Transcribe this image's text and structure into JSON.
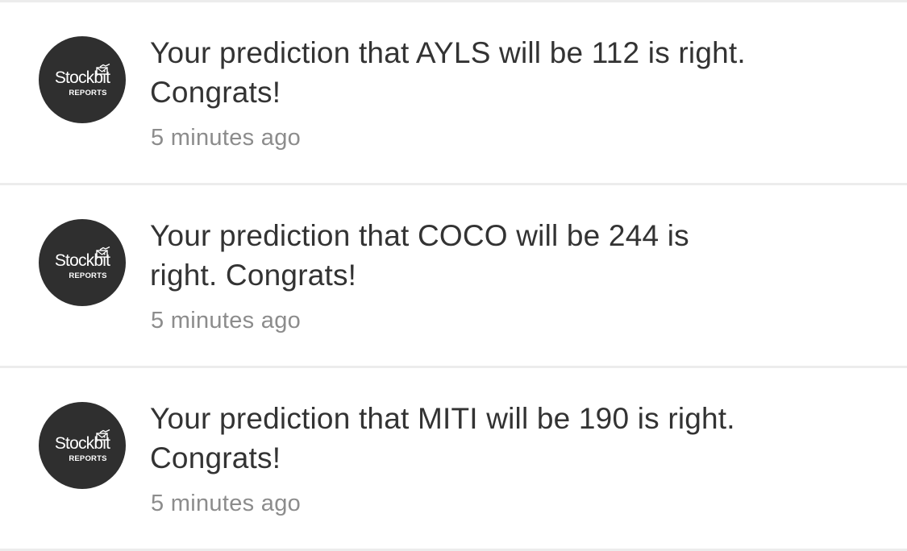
{
  "notifications": [
    {
      "avatar": {
        "brand": "Stockbit",
        "sub": "REPORTS",
        "icon": "chart-envelope-icon"
      },
      "message": "Your prediction that AYLS will be 112 is right. Congrats!",
      "time": "5 minutes ago"
    },
    {
      "avatar": {
        "brand": "Stockbit",
        "sub": "REPORTS",
        "icon": "chart-envelope-icon"
      },
      "message": "Your prediction that COCO will be 244 is right. Congrats!",
      "time": "5 minutes ago"
    },
    {
      "avatar": {
        "brand": "Stockbit",
        "sub": "REPORTS",
        "icon": "chart-envelope-icon"
      },
      "message": "Your prediction that MITI will be 190 is right. Congrats!",
      "time": "5 minutes ago"
    }
  ],
  "colors": {
    "avatar_bg": "#2f2f2f",
    "message_text": "#333333",
    "time_text": "#8c8c8c",
    "divider": "#ececec"
  }
}
